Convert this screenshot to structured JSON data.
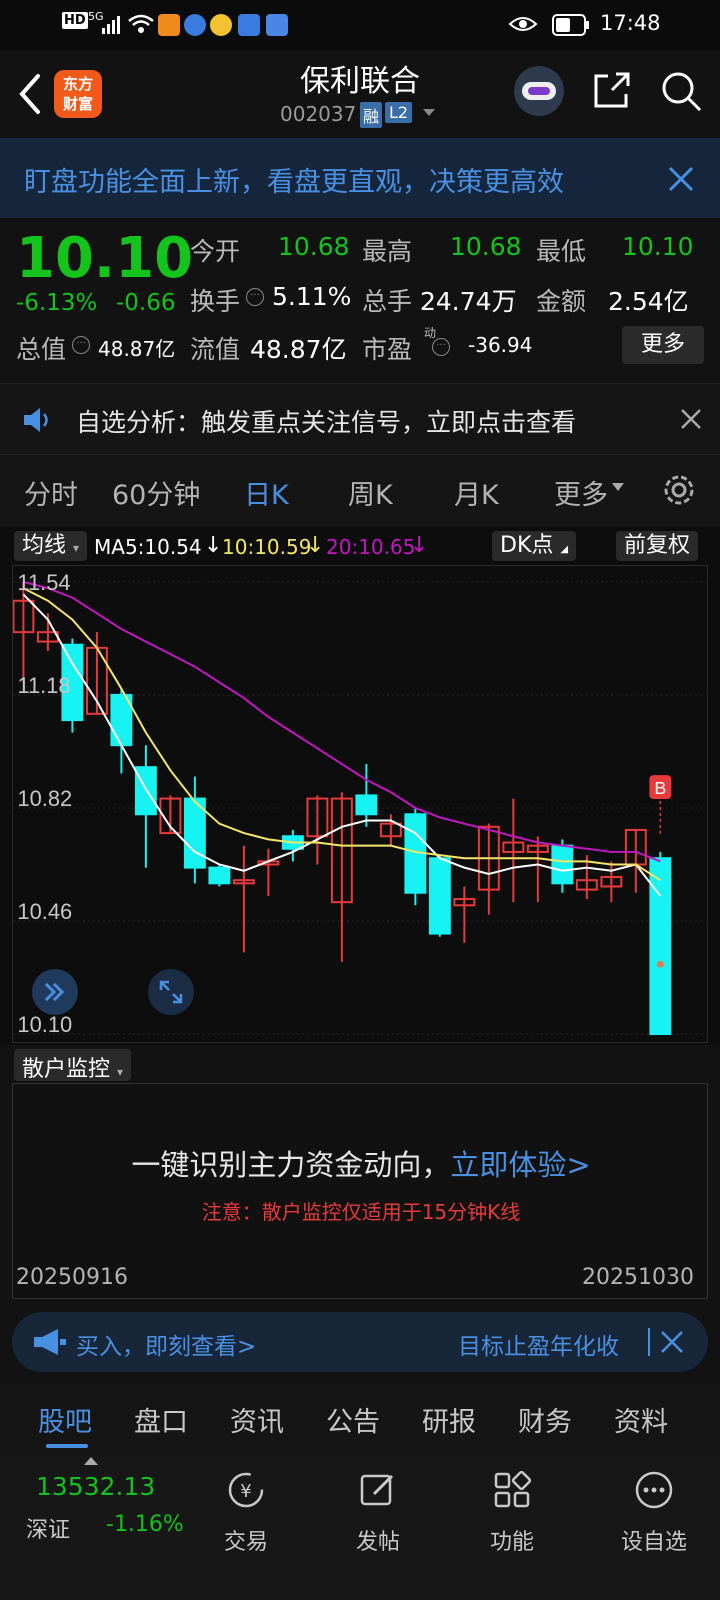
{
  "status_bar": {
    "left_badges": [
      "HD",
      "5G"
    ],
    "time": "17:48"
  },
  "header": {
    "back_label": "‹",
    "logo_text_1": "东方",
    "logo_text_2": "财富",
    "stock_name": "保利联合",
    "stock_code": "002037",
    "tag_rong": "融",
    "tag_l2": "L2"
  },
  "banner": {
    "text": "盯盘功能全面上新，看盘更直观，决策更高效"
  },
  "quote": {
    "price": "10.10",
    "change_pct": "-6.13%",
    "change": "-0.66",
    "open_label": "今开",
    "open_value": "10.68",
    "high_label": "最高",
    "high_value": "10.68",
    "low_label": "最低",
    "low_value": "10.10",
    "turnover_label": "换手",
    "turnover_value": "5.11%",
    "volume_label": "总手",
    "volume_value": "24.74万",
    "amount_label": "金额",
    "amount_value": "2.54亿",
    "mktcap_label": "总值",
    "mktcap_value": "48.87亿",
    "float_label": "流值",
    "float_value": "48.87亿",
    "pe_label": "市盈",
    "pe_sup": "动",
    "pe_value": "-36.94",
    "more_label": "更多"
  },
  "notice": {
    "text": "自选分析：触发重点关注信号，立即点击查看"
  },
  "period_tabs": [
    "分时",
    "60分钟",
    "日K",
    "周K",
    "月K",
    "更多"
  ],
  "active_tab": "日K",
  "chart_controls": {
    "ma_selector": "均线",
    "ma5": "MA5:10.54",
    "ma10": "10:10.59",
    "ma20": "20:10.65",
    "dk_label": "DK点",
    "adjust_label": "前复权",
    "b_marker": "B"
  },
  "chart_data": {
    "type": "candlestick",
    "y_ticks": [
      "11.54",
      "11.18",
      "10.82",
      "10.46",
      "10.10"
    ],
    "ylim": [
      10.1,
      11.54
    ],
    "x_start": "20250916",
    "x_end": "20251030",
    "candles": [
      {
        "o": 11.38,
        "c": 11.48,
        "h": 11.54,
        "l": 11.22
      },
      {
        "o": 11.35,
        "c": 11.38,
        "h": 11.44,
        "l": 11.32
      },
      {
        "o": 11.34,
        "c": 11.1,
        "h": 11.36,
        "l": 11.06
      },
      {
        "o": 11.12,
        "c": 11.33,
        "h": 11.38,
        "l": 11.12
      },
      {
        "o": 11.18,
        "c": 11.02,
        "h": 11.2,
        "l": 10.93
      },
      {
        "o": 10.95,
        "c": 10.8,
        "h": 11.02,
        "l": 10.63
      },
      {
        "o": 10.74,
        "c": 10.85,
        "h": 10.86,
        "l": 10.74
      },
      {
        "o": 10.85,
        "c": 10.63,
        "h": 10.92,
        "l": 10.58
      },
      {
        "o": 10.63,
        "c": 10.58,
        "h": 10.64,
        "l": 10.57
      },
      {
        "o": 10.58,
        "c": 10.59,
        "h": 10.7,
        "l": 10.36
      },
      {
        "o": 10.64,
        "c": 10.65,
        "h": 10.69,
        "l": 10.54
      },
      {
        "o": 10.73,
        "c": 10.69,
        "h": 10.75,
        "l": 10.65
      },
      {
        "o": 10.73,
        "c": 10.85,
        "h": 10.86,
        "l": 10.64
      },
      {
        "o": 10.52,
        "c": 10.85,
        "h": 10.87,
        "l": 10.33
      },
      {
        "o": 10.86,
        "c": 10.8,
        "h": 10.96,
        "l": 10.76
      },
      {
        "o": 10.73,
        "c": 10.77,
        "h": 10.8,
        "l": 10.7
      },
      {
        "o": 10.8,
        "c": 10.55,
        "h": 10.82,
        "l": 10.51
      },
      {
        "o": 10.66,
        "c": 10.42,
        "h": 10.67,
        "l": 10.41
      },
      {
        "o": 10.51,
        "c": 10.53,
        "h": 10.57,
        "l": 10.39
      },
      {
        "o": 10.56,
        "c": 10.76,
        "h": 10.77,
        "l": 10.48
      },
      {
        "o": 10.68,
        "c": 10.71,
        "h": 10.85,
        "l": 10.52
      },
      {
        "o": 10.68,
        "c": 10.7,
        "h": 10.73,
        "l": 10.52
      },
      {
        "o": 10.7,
        "c": 10.58,
        "h": 10.72,
        "l": 10.55
      },
      {
        "o": 10.56,
        "c": 10.59,
        "h": 10.67,
        "l": 10.53
      },
      {
        "o": 10.57,
        "c": 10.6,
        "h": 10.65,
        "l": 10.52
      },
      {
        "o": 10.64,
        "c": 10.75,
        "h": 10.75,
        "l": 10.55
      },
      {
        "o": 10.66,
        "c": 10.1,
        "h": 10.68,
        "l": 10.1
      }
    ],
    "ma5": [
      11.5,
      11.42,
      11.28,
      11.16,
      11.02,
      10.88,
      10.76,
      10.68,
      10.64,
      10.62,
      10.65,
      10.68,
      10.72,
      10.76,
      10.78,
      10.78,
      10.74,
      10.66,
      10.63,
      10.61,
      10.63,
      10.64,
      10.62,
      10.63,
      10.62,
      10.64,
      10.54
    ],
    "ma10": [
      11.52,
      11.48,
      11.42,
      11.33,
      11.2,
      11.06,
      10.94,
      10.84,
      10.77,
      10.74,
      10.72,
      10.71,
      10.71,
      10.7,
      10.7,
      10.7,
      10.68,
      10.67,
      10.66,
      10.66,
      10.66,
      10.66,
      10.65,
      10.65,
      10.64,
      10.64,
      10.59
    ],
    "ma20": [
      11.54,
      11.52,
      11.49,
      11.44,
      11.39,
      11.35,
      11.31,
      11.27,
      11.22,
      11.17,
      11.11,
      11.06,
      11.01,
      10.96,
      10.91,
      10.87,
      10.82,
      10.79,
      10.77,
      10.75,
      10.73,
      10.71,
      10.7,
      10.69,
      10.68,
      10.68,
      10.65
    ]
  },
  "retail_monitor": {
    "selector": "散户监控",
    "headline": "一键识别主力资金动向，",
    "cta": "立即体验>",
    "note": "注意：散户监控仅适用于15分钟K线"
  },
  "ad_bar": {
    "left_text": "买入，即刻查看>",
    "right_text": "目标止盈年化收"
  },
  "bottom_tabs": [
    "股吧",
    "盘口",
    "资讯",
    "公告",
    "研报",
    "财务",
    "资料"
  ],
  "footer": {
    "index_value": "13532.13",
    "index_name": "深证",
    "index_change": "-1.16%",
    "items": [
      "交易",
      "发帖",
      "功能",
      "设自选"
    ]
  },
  "colors": {
    "up": "#e83a3a",
    "down": "#17f2f2",
    "ma5": "#ffffff",
    "ma10": "#f5e66a",
    "ma20": "#c218c2",
    "accent_blue": "#4a90e2"
  }
}
